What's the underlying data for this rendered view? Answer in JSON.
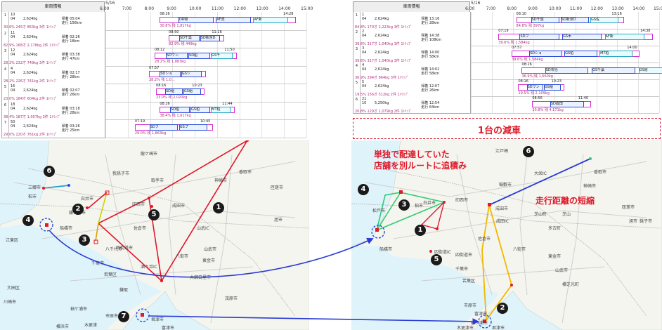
{
  "left_panel": {
    "header": "車両情報",
    "date": "5/16",
    "time_labels": [
      "6:00",
      "7:00",
      "8:00",
      "9:00",
      "10:00",
      "11:00",
      "12:00",
      "13:00",
      "14:00",
      "15:00"
    ],
    "rows": [
      {
        "idx": "1",
        "no": "10",
        "t": "04",
        "kg": "2,624kg",
        "arr_label": "帰着",
        "arr": "05:04",
        "dist_label": "走行",
        "dist": "156km",
        "pct": "30.6%",
        "w": "245才",
        "wk": "863kg",
        "stops": "3件",
        "trips": "1ﾄﾘｯﾌﾟ",
        "start": "08:26",
        "end": "14:28",
        "b": [
          "DR物",
          "AF流",
          "AF新"
        ],
        "load": "30.8%",
        "left": "残 1,817kg"
      },
      {
        "idx": "2",
        "no": "11",
        "t": "04",
        "kg": "2,624kg",
        "arr_label": "帰着",
        "arr": "02:26",
        "dist_label": "走行",
        "dist": "18km",
        "pct": "82.9%",
        "w": "168才",
        "wk": "2,178kg",
        "stops": "2件",
        "trips": "1ﾄﾘｯﾌﾟ",
        "start": "08:50",
        "end": "11:16",
        "b": [
          "SD千葉",
          "SD新京D"
        ],
        "load": "82.9%",
        "left": "残 449kg"
      },
      {
        "idx": "3",
        "no": "12",
        "t": "04",
        "kg": "2,624kg",
        "arr_label": "帰着",
        "arr": "03:38",
        "dist_label": "走行",
        "dist": "47km",
        "pct": "28.2%",
        "w": "232才",
        "wk": "749kg",
        "stops": "3件",
        "trips": "1ﾄﾘｯﾌﾟ",
        "start": "08:12",
        "end": "11:50",
        "b": [
          "SDワン",
          "SD船",
          "GS千"
        ],
        "load": "28.2%",
        "left": "残 1,883kg"
      },
      {
        "idx": "4",
        "no": "4",
        "t": "04",
        "kg": "2,624kg",
        "arr_label": "帰着",
        "arr": "02:17",
        "dist_label": "走行",
        "dist": "28km",
        "pct": "28.2%",
        "w": "226才",
        "wk": "741kg",
        "stops": "2件",
        "trips": "1ﾄﾘｯﾌﾟ",
        "start": "07:57",
        "end": "",
        "b": [
          "SDショ",
          "GSシ"
        ],
        "load": "28.2%",
        "left": "残 1,0..."
      },
      {
        "idx": "5",
        "no": "16",
        "t": "04",
        "kg": "2,624kg",
        "arr_label": "帰着",
        "arr": "02:07",
        "dist_label": "走行",
        "dist": "26km",
        "pct": "23.0%",
        "w": "184才",
        "wk": "604kg",
        "stops": "2件",
        "trips": "1ﾄﾘｯﾌﾟ",
        "start": "08:16",
        "end": "10:23",
        "b": [
          "SD稲",
          "GS稲"
        ],
        "load": "23.0%",
        "left": "残 2,020kg"
      },
      {
        "idx": "6",
        "no": "18",
        "t": "04",
        "kg": "2,624kg",
        "arr_label": "帰着",
        "arr": "03:18",
        "dist_label": "走行",
        "dist": "28km",
        "pct": "38.4%",
        "w": "187才",
        "wk": "1,007kg",
        "stops": "3件",
        "trips": "1ﾄﾘｯﾌﾟ",
        "start": "08:26",
        "end": "11:44",
        "b": [
          "SD柏",
          "GS柏",
          "MT柏"
        ],
        "load": "38.4%",
        "left": "残 1,617kg"
      },
      {
        "idx": "7",
        "no": "50",
        "t": "04",
        "kg": "2,624kg",
        "arr_label": "帰着",
        "arr": "03:26",
        "dist_label": "走行",
        "dist": "25km",
        "pct": "29.0%",
        "w": "220才",
        "wk": "761kg",
        "stops": "2件",
        "trips": "1ﾄﾘｯﾌﾟ",
        "start": "07:19",
        "end": "10:45",
        "b": [
          "SDフ",
          "GSプ"
        ],
        "load": "29.0%",
        "left": "残 1,863kg"
      }
    ]
  },
  "right_panel": {
    "header": "車両情報",
    "date": "5/16",
    "time_labels": [
      "6:00",
      "7:00",
      "8:00",
      "9:00",
      "10:00",
      "11:00",
      "12:00",
      "13:00",
      "14:00",
      "15:00"
    ],
    "rows": [
      {
        "idx": "1",
        "no": "1",
        "t": "04",
        "kg": "2,624kg",
        "arr_label": "帰着",
        "arr": "13:16",
        "dist_label": "走行",
        "dist": "28km",
        "pct": "84.8%",
        "w": "170才",
        "wk": "2,223kg",
        "stops": "3件",
        "trips": "1ﾄﾘｯﾌﾟ",
        "start": "08:10",
        "end": "13:16",
        "b": [
          "SD千葉",
          "SD新京D",
          "GS佐"
        ],
        "load": "84.8%",
        "left": "残 397kg"
      },
      {
        "idx": "2",
        "no": "2",
        "t": "04",
        "kg": "2,624kg",
        "arr_label": "帰着",
        "arr": "14:38",
        "dist_label": "走行",
        "dist": "108km",
        "pct": "39.6%",
        "w": "317才",
        "wk": "1,040kg",
        "stops": "3件",
        "trips": "1ﾄﾘｯﾌﾟ",
        "start": "07:19",
        "end": "14:38",
        "b": [
          "SDフ",
          "GS木",
          "AF新"
        ],
        "load": "39.6%",
        "left": "残 1,584kg"
      },
      {
        "idx": "3",
        "no": "3",
        "t": "04",
        "kg": "2,624kg",
        "arr_label": "帰着",
        "arr": "14:00",
        "dist_label": "走行",
        "dist": "58km",
        "pct": "39.6%",
        "w": "317才",
        "wk": "1,040kg",
        "stops": "3件",
        "trips": "1ﾄﾘｯﾌﾟ",
        "start": "07:57",
        "end": "14:00",
        "b": [
          "SDショ",
          "GS柏",
          "MT柏"
        ],
        "load": "39.6%",
        "left": "残 1,584kg"
      },
      {
        "idx": "4",
        "no": "4",
        "t": "04",
        "kg": "2,624kg",
        "arr_label": "帰着",
        "arr": "14:02",
        "dist_label": "走行",
        "dist": "58km",
        "pct": "36.9%",
        "w": "294才",
        "wk": "964kg",
        "stops": "3件",
        "trips": "1ﾄﾘｯﾌﾟ",
        "start": "08:26",
        "end": "16:28",
        "b": [
          "SD市島",
          "GS千葉",
          "GS館"
        ],
        "load": "36.9%",
        "left": "残 1,660kg"
      },
      {
        "idx": "5",
        "no": "5",
        "t": "04",
        "kg": "2,624kg",
        "arr_label": "帰着",
        "arr": "12:07",
        "dist_label": "走行",
        "dist": "26km",
        "pct": "19.5%",
        "w": "156才",
        "wk": "512kg",
        "stops": "2件",
        "trips": "1ﾄﾘｯﾌﾟ",
        "start": "08:16",
        "end": "10:23",
        "b": [
          "SDワン",
          "GS稲"
        ],
        "load": "19.5%",
        "left": "残 2,109kg"
      },
      {
        "idx": "6",
        "no": "21",
        "t": "10",
        "kg": "5,250kg",
        "arr_label": "帰着",
        "arr": "12:54",
        "dist_label": "走行",
        "dist": "64km",
        "pct": "20.8%",
        "w": "129才",
        "wk": "1,079kg",
        "stops": "2件",
        "trips": "1ﾄﾘｯﾌﾟ",
        "start": "08:56",
        "end": "11:40",
        "b": [
          "SD成田"
        ],
        "load": "20.8%",
        "left": "残 4,171kg"
      }
    ]
  },
  "annotations": {
    "reduction": "1台の減車",
    "consolidation_line1": "単独で配達していた",
    "consolidation_line2": "店舗を別ルートに追積み",
    "shortening": "走行距離の短縮",
    "badges": [
      "1",
      "2",
      "3",
      "4",
      "5",
      "6",
      "7"
    ]
  },
  "places": {
    "left": [
      "龍ケ崎市",
      "取手市",
      "柏市",
      "我孫子市",
      "印西市",
      "成田市",
      "白井市",
      "鎌ケ谷市",
      "船橋市",
      "八千代市",
      "佐倉市",
      "四街道市",
      "千葉市",
      "若葉区",
      "市原市",
      "木更津",
      "袖ケ浦市",
      "香取市",
      "神崎市",
      "匝瑳市",
      "旭市",
      "東金市",
      "八街市",
      "山武市",
      "大網白里市",
      "茂原市",
      "君津市",
      "富津市",
      "江東区",
      "大田区",
      "川崎市",
      "横浜市",
      "三郷市",
      "酒々井IC",
      "鎌取",
      "山武IC"
    ],
    "right": [
      "江戸崎",
      "稲敷市",
      "成田市",
      "印西市",
      "白井市",
      "柏市",
      "松戸市",
      "船橋市",
      "四街道市",
      "千葉市",
      "若葉区",
      "佐倉市",
      "香取市",
      "神崎市",
      "芝山",
      "匝瑳市",
      "旭市",
      "東金市",
      "山武市",
      "八街市",
      "横芝光町",
      "市原市",
      "袖ケ浦市",
      "木更津市",
      "富津市",
      "君津市",
      "四街道IC",
      "成田IC",
      "大栄IC",
      "銚子市",
      "多古町",
      "芝山町"
    ]
  }
}
